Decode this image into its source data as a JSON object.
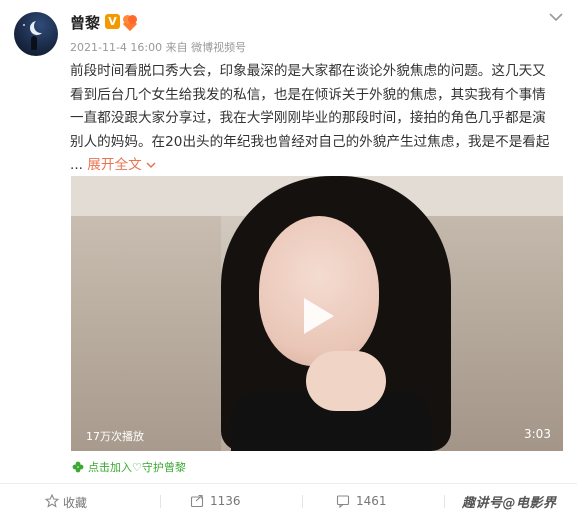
{
  "user": {
    "name": "曾黎",
    "verified_mark": "V",
    "time": "2021-11-4 16:00",
    "source": "来自 微博视频号"
  },
  "post": {
    "lines": [
      "前段时间看脱口秀大会，印象最深的是大家都在谈论外貌焦虑的问题。这几天又",
      "看到后台几个女生给我发的私信，也是在倾诉关于外貌的焦虑，其实我有个事情",
      "一直都没跟大家分享过，我在大学刚刚毕业的那段时间，接拍的角色几乎都是演",
      "别人的妈妈。在20出头的年纪我也曾经对自己的外貌产生过焦虑，我是不是看起"
    ],
    "ellipsis": "...",
    "expand_label": "展开全文",
    "expand_icon": "chevron-down-icon"
  },
  "video": {
    "views": "17万次播放",
    "duration": "3:03"
  },
  "join": {
    "label": "点击加入♡守护曾黎"
  },
  "actions": {
    "favorite_label": "收藏",
    "share_count": "1136",
    "comment_count": "1461"
  },
  "watermark": "趣讲号@电影界",
  "colors": {
    "expand": "#eb7350",
    "verified": "#f39a00",
    "join": "#3aa832"
  }
}
